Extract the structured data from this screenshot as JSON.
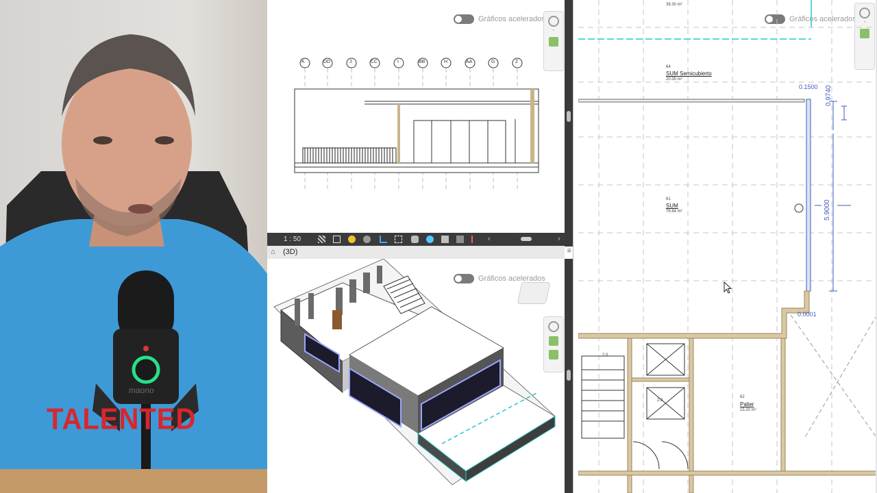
{
  "webcam": {
    "shirt_text": "TALENTED",
    "mic_text": "maono"
  },
  "elevation_view": {
    "toggle_label": "Gráficos acelerados",
    "grid_labels": [
      "K",
      "DD",
      "J",
      "CC",
      "I",
      "BB",
      "H",
      "AA",
      "G",
      "Z"
    ]
  },
  "view_bar": {
    "scale": "1 : 50"
  },
  "view3d": {
    "title": "(3D)",
    "toggle_label": "Gráficos acelerados"
  },
  "plan_view": {
    "toggle_label": "Gráficos acelerados",
    "top_area": "39.30 m²",
    "rooms": [
      {
        "number": "64",
        "name": "SUM Semicubierto",
        "area": "20.35 m²"
      },
      {
        "number": "61",
        "name": "SUM",
        "area": "76.64 m²"
      },
      {
        "number": "62",
        "name": "Palier",
        "area": "15.20 m²"
      }
    ],
    "dimensions": [
      "0.1500",
      "0.9740",
      "5.9000",
      "0.0001"
    ],
    "small_labels": [
      "2.0",
      "2.0"
    ]
  },
  "colors": {
    "wall_fill": "#d8c8a6",
    "wall_stroke": "#9b8455",
    "accent_cyan": "#25c7c7",
    "dim_blue": "#3b5bbf"
  }
}
